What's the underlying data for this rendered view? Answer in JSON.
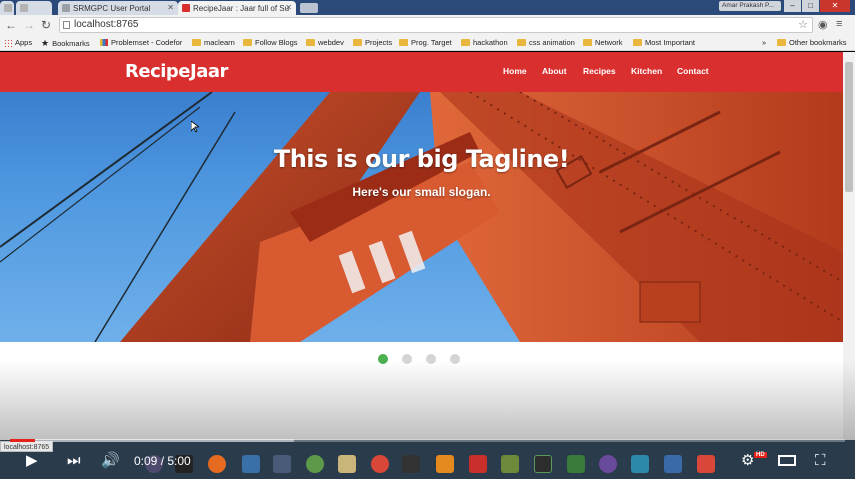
{
  "browser": {
    "tabs": [
      {
        "label": "",
        "favicon_color": "#b3b3b3"
      },
      {
        "label": "",
        "favicon_color": "#b3b3b3"
      },
      {
        "label": "SRMGPC User Portal",
        "favicon_color": "#9aa0a6"
      },
      {
        "label": "RecipeJaar : Jaar full of Su",
        "favicon_color": "#d92f2f"
      }
    ],
    "profile_label": "Amar Prakash P...",
    "window_buttons": [
      "–",
      "□",
      "✕"
    ],
    "address": "localhost:8765",
    "icons": [
      "back-arrow-icon",
      "forward-arrow-icon",
      "reload-icon",
      "star-icon",
      "extension-icon",
      "menu-icon"
    ]
  },
  "bookmarks": {
    "items": [
      {
        "label": "Apps",
        "icon": "apps-icon"
      },
      {
        "label": "Bookmarks",
        "icon": "star-icon"
      },
      {
        "label": "Problemset - Codefor",
        "icon": "chart-icon"
      },
      {
        "label": "maclearn",
        "icon": "folder-icon"
      },
      {
        "label": "Follow Blogs",
        "icon": "folder-icon"
      },
      {
        "label": "webdev",
        "icon": "folder-icon"
      },
      {
        "label": "Projects",
        "icon": "folder-icon"
      },
      {
        "label": "Prog. Target",
        "icon": "folder-icon"
      },
      {
        "label": "hackathon",
        "icon": "folder-icon"
      },
      {
        "label": "css animation",
        "icon": "folder-icon"
      },
      {
        "label": "Network",
        "icon": "folder-icon"
      },
      {
        "label": "Most Important",
        "icon": "folder-icon"
      }
    ],
    "overflow": "»",
    "other": "Other bookmarks"
  },
  "site": {
    "brand": "RecipeJaar",
    "accent_color": "#d92f2f",
    "nav": [
      "Home",
      "About",
      "Recipes",
      "Kitchen",
      "Contact"
    ],
    "hero": {
      "tagline": "This is our big Tagline!",
      "slogan": "Here's our small slogan."
    },
    "carousel": {
      "slides": 4,
      "active_index": 0,
      "active_color": "#4caf50"
    }
  },
  "status_bar": {
    "url": "localhost:8765"
  },
  "player": {
    "time": "0:09 / 5:00",
    "progress_fraction": 0.03,
    "buffered_fraction": 0.34,
    "hd_badge": "HD",
    "controls": [
      "play-icon",
      "next-icon",
      "volume-icon",
      "settings-icon",
      "theater-mode-icon",
      "fullscreen-icon"
    ]
  }
}
